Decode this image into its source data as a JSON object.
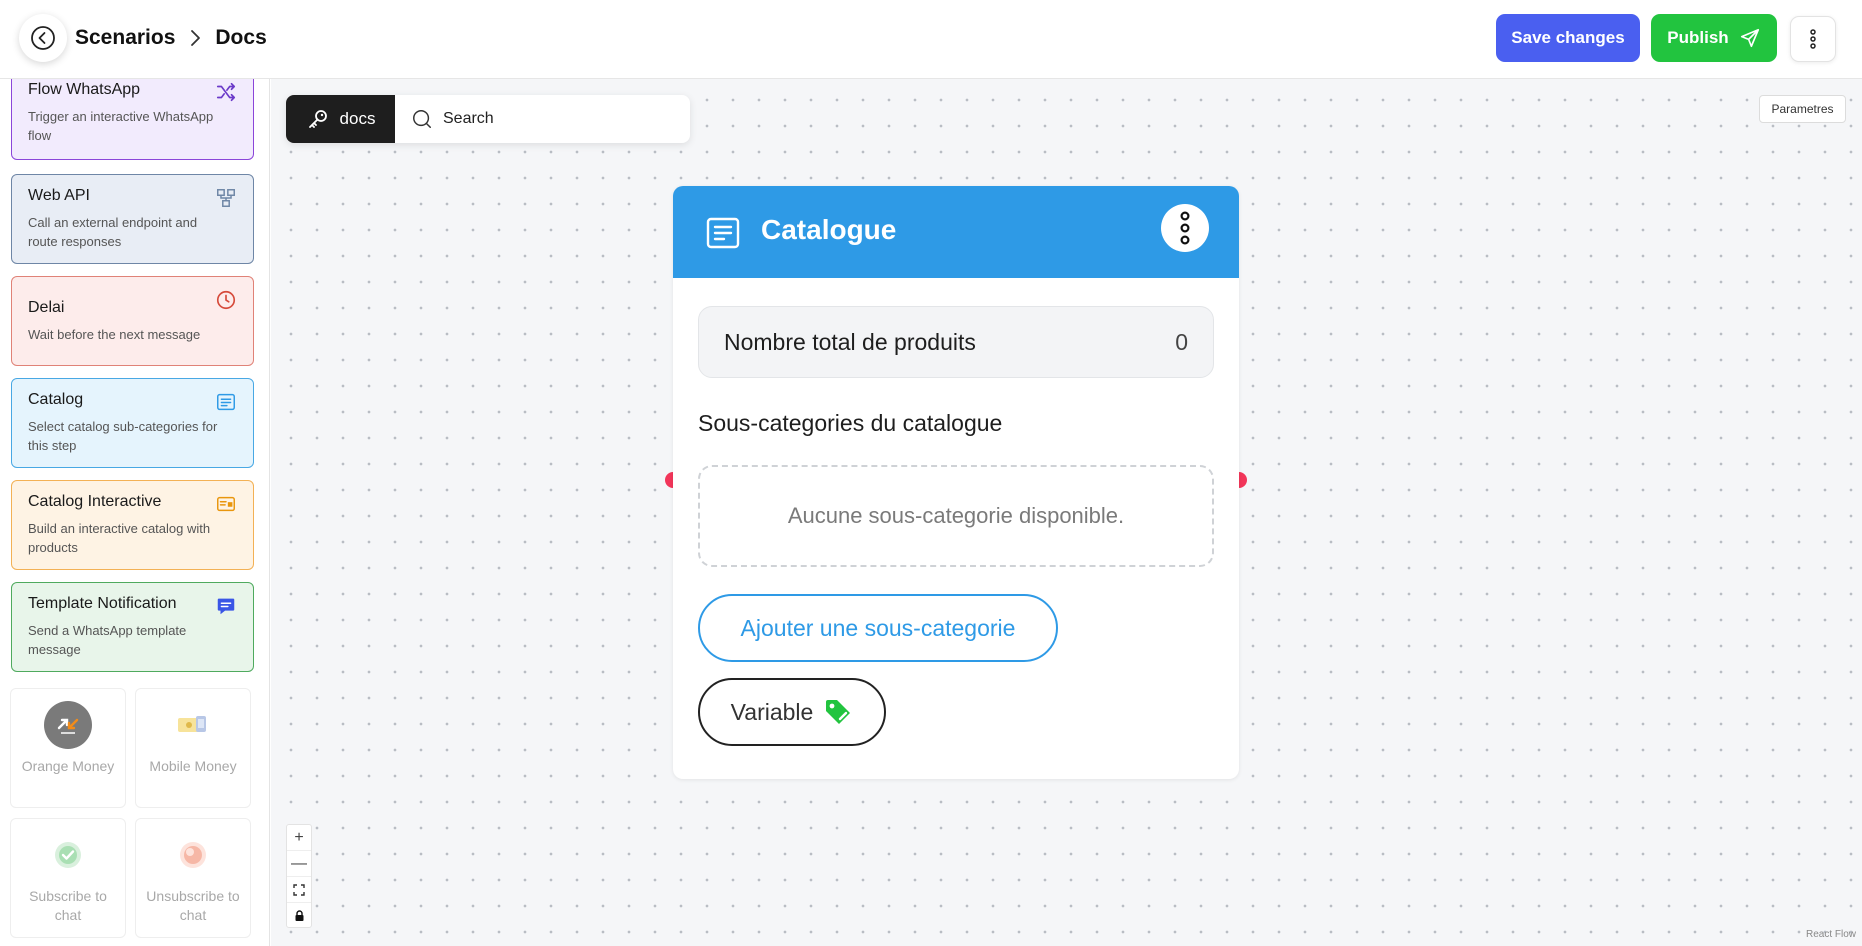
{
  "header": {
    "breadcrumb": [
      "Scenarios",
      "Docs"
    ],
    "save_label": "Save changes",
    "publish_label": "Publish"
  },
  "sidebar": {
    "nodes": [
      {
        "title": "Flow WhatsApp",
        "desc": "Trigger an interactive WhatsApp flow",
        "icon": "shuffle-icon",
        "bg": "#f2ebfd",
        "border": "#8b45d9",
        "icon_color": "#6b3ac9"
      },
      {
        "title": "Web API",
        "desc": "Call an external endpoint and route responses",
        "icon": "network-icon",
        "bg": "#e8edf5",
        "border": "#6e86a6",
        "icon_color": "#6e86a6"
      },
      {
        "title": "Delai",
        "desc": "Wait before the next message",
        "icon": "clock-icon",
        "bg": "#fdeceb",
        "border": "#e08277",
        "icon_color": "#d64a3a"
      },
      {
        "title": "Catalog",
        "desc": "Select catalog sub-categories for this step",
        "icon": "list-icon",
        "bg": "#e5f4fd",
        "border": "#48a8e4",
        "icon_color": "#2e9ae6"
      },
      {
        "title": "Catalog Interactive",
        "desc": "Build an interactive catalog with products",
        "icon": "card-icon",
        "bg": "#fef3e4",
        "border": "#f3b155",
        "icon_color": "#e9960d"
      },
      {
        "title": "Template Notification",
        "desc": "Send a WhatsApp template message",
        "icon": "chat-icon",
        "bg": "#e8f5ea",
        "border": "#4faa5e",
        "icon_color": "#3a56e6"
      }
    ],
    "tiles": [
      {
        "label": "Orange Money",
        "icon": "orange-money-icon"
      },
      {
        "label": "Mobile Money",
        "icon": "mobile-money-icon"
      },
      {
        "label": "Subscribe to chat",
        "icon": "subscribe-icon"
      },
      {
        "label": "Unsubscribe to chat",
        "icon": "unsubscribe-icon"
      }
    ]
  },
  "canvas": {
    "docs_label": "docs",
    "search_placeholder": "Search",
    "params_label": "Parametres",
    "react_flow_label": "React Flow"
  },
  "node": {
    "title": "Catalogue",
    "count_label": "Nombre total de produits",
    "count_value": "0",
    "subcat_title": "Sous-categories du catalogue",
    "empty_text": "Aucune sous-categorie disponible.",
    "add_label": "Ajouter une sous-categorie",
    "variable_label": "Variable",
    "header_color": "#2e9ae6"
  },
  "zoom": {
    "plus": "+",
    "minus": "—"
  }
}
